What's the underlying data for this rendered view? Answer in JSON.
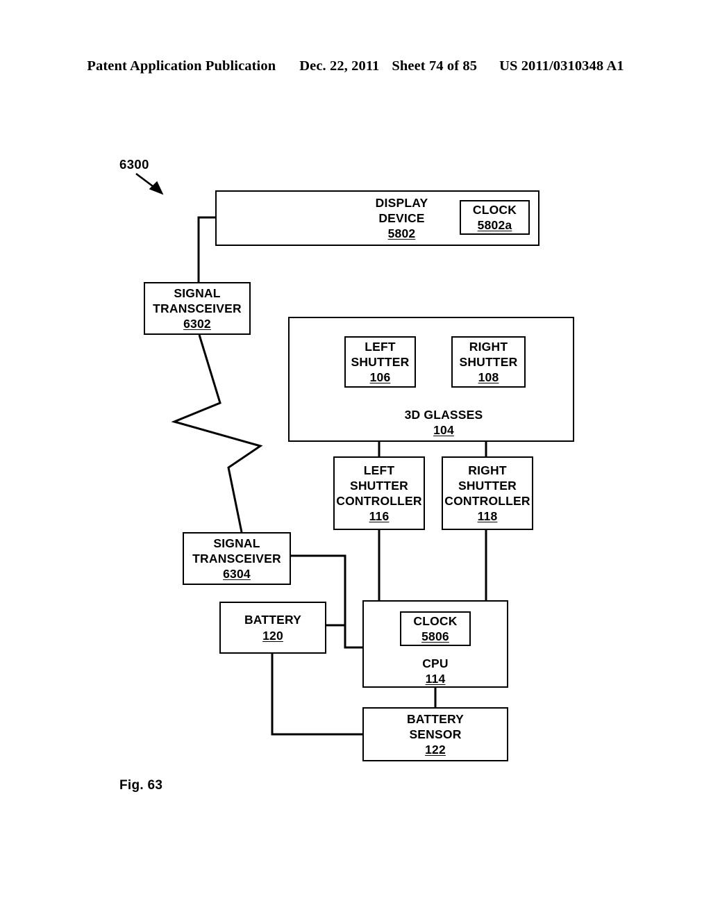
{
  "header": {
    "publication": "Patent Application Publication",
    "date": "Dec. 22, 2011",
    "sheet": "Sheet 74 of 85",
    "patent_number": "US 2011/0310348 A1"
  },
  "figure": {
    "caption": "Fig. 63",
    "callout_ref": "6300"
  },
  "blocks": {
    "display_device": {
      "line1": "DISPLAY",
      "line2": "DEVICE",
      "ref": "5802"
    },
    "display_clock": {
      "line1": "CLOCK",
      "ref": "5802a"
    },
    "signal_transceiver_top": {
      "line1": "SIGNAL",
      "line2": "TRANSCEIVER",
      "ref": "6302"
    },
    "glasses": {
      "line1": "3D GLASSES",
      "ref": "104"
    },
    "left_shutter": {
      "line1": "LEFT",
      "line2": "SHUTTER",
      "ref": "106"
    },
    "right_shutter": {
      "line1": "RIGHT",
      "line2": "SHUTTER",
      "ref": "108"
    },
    "left_shutter_controller": {
      "line1": "LEFT",
      "line2": "SHUTTER",
      "line3": "CONTROLLER",
      "ref": "116"
    },
    "right_shutter_controller": {
      "line1": "RIGHT",
      "line2": "SHUTTER",
      "line3": "CONTROLLER",
      "ref": "118"
    },
    "signal_transceiver_bottom": {
      "line1": "SIGNAL",
      "line2": "TRANSCEIVER",
      "ref": "6304"
    },
    "battery": {
      "line1": "BATTERY",
      "ref": "120"
    },
    "cpu": {
      "line1": "CPU",
      "ref": "114"
    },
    "cpu_clock": {
      "line1": "CLOCK",
      "ref": "5806"
    },
    "battery_sensor": {
      "line1": "BATTERY",
      "line2": "SENSOR",
      "ref": "122"
    }
  },
  "colors": {
    "ink": "#000000",
    "paper": "#ffffff"
  }
}
